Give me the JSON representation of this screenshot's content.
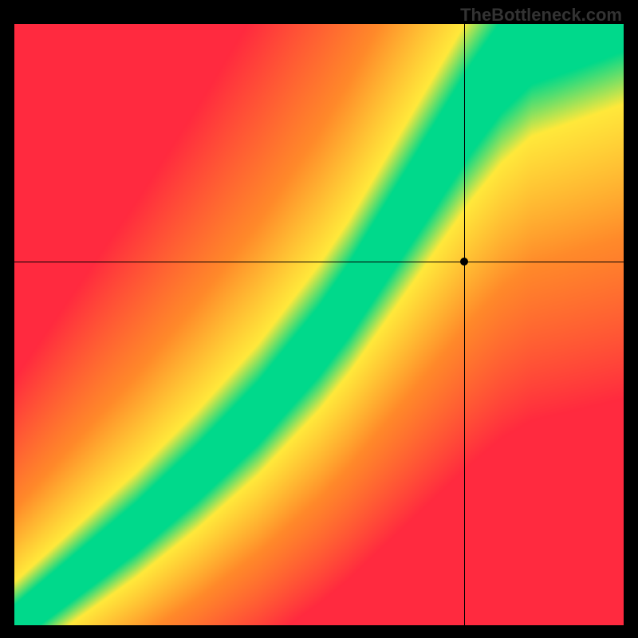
{
  "watermark": "TheBottleneck.com",
  "chart_data": {
    "type": "heatmap",
    "title": "",
    "xlabel": "",
    "ylabel": "",
    "xlim": [
      0,
      1
    ],
    "ylim": [
      0,
      1
    ],
    "colorscale": "bottleneck-red-yellow-green",
    "optimal_curve": {
      "description": "S-shaped ridge from bottom-left to top-right where value is maximal (green)",
      "x": [
        0.0,
        0.1,
        0.2,
        0.3,
        0.4,
        0.5,
        0.55,
        0.6,
        0.65,
        0.7,
        0.75,
        0.8,
        0.85,
        0.9
      ],
      "y": [
        0.0,
        0.08,
        0.16,
        0.25,
        0.35,
        0.47,
        0.54,
        0.62,
        0.7,
        0.78,
        0.86,
        0.93,
        0.98,
        1.0
      ]
    },
    "crosshair": {
      "x": 0.738,
      "y": 0.605
    },
    "marker": {
      "x": 0.738,
      "y": 0.605
    },
    "corners_value": {
      "bottom_left": "low (red, near origin diverges to green ridge start)",
      "top_left": "low (red)",
      "bottom_right": "low (red)",
      "top_right": "medium (yellow-green near ridge)"
    }
  },
  "colors": {
    "ridge_green": "#00D98B",
    "yellow": "#FFE93B",
    "orange": "#FF8A2A",
    "red": "#FF2A3F",
    "black": "#000000"
  }
}
